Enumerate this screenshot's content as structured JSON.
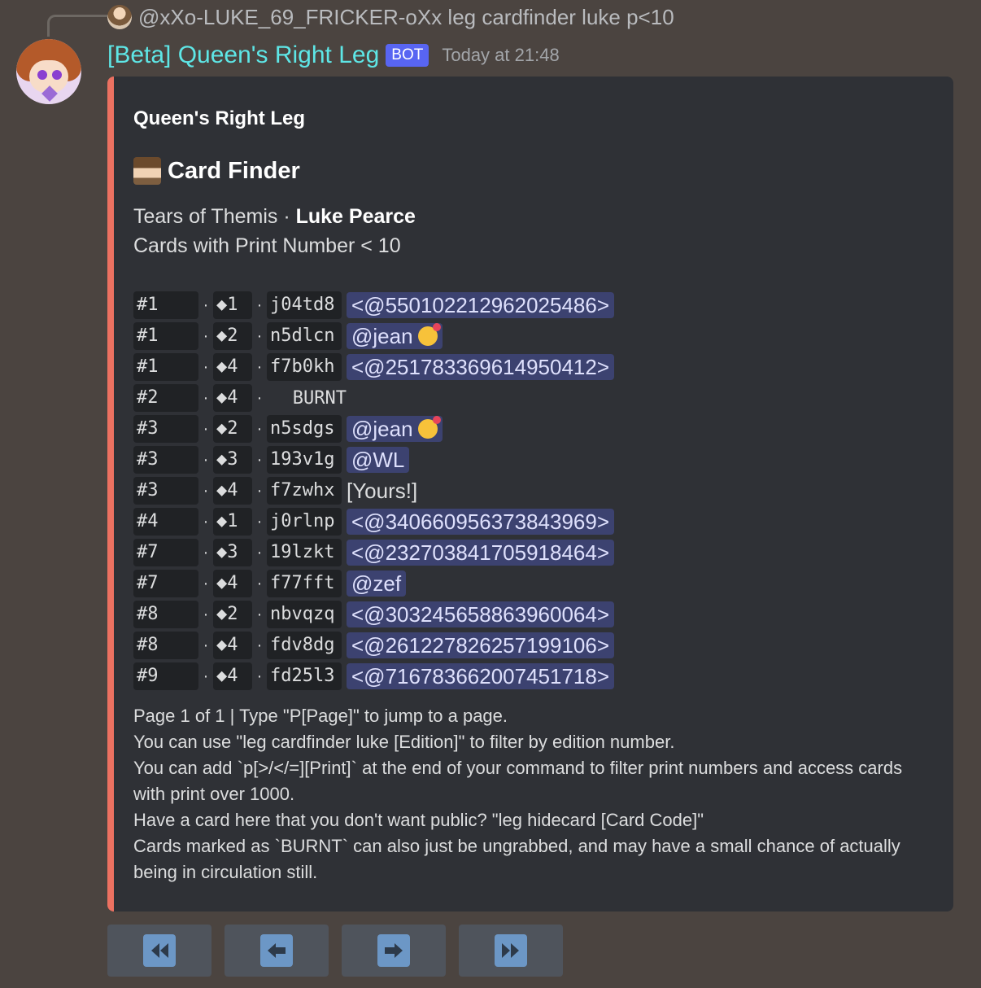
{
  "reply": {
    "text": "@xXo-LUKE_69_FRICKER-oXx leg cardfinder luke p<10"
  },
  "message": {
    "author": "[Beta] Queen's Right Leg",
    "bot_tag": "BOT",
    "timestamp": "Today at 21:48"
  },
  "embed": {
    "accent_color": "#ec7161",
    "author": "Queen's Right Leg",
    "title": "Card Finder",
    "desc_series": "Tears of Themis · ",
    "desc_character": "Luke Pearce",
    "desc_filter": "Cards with Print Number < 10",
    "rows": [
      {
        "num": "#1",
        "edition": "◆1",
        "code": "j04td8",
        "owner": "<@550102212962025486>",
        "type": "mention"
      },
      {
        "num": "#1",
        "edition": "◆2",
        "code": "n5dlcn",
        "owner": "@jean",
        "type": "mention-emoji"
      },
      {
        "num": "#1",
        "edition": "◆4",
        "code": "f7b0kh",
        "owner": "<@251783369614950412>",
        "type": "mention"
      },
      {
        "num": "#2",
        "edition": "◆4",
        "code": "BURNT",
        "owner": "",
        "type": "burnt"
      },
      {
        "num": "#3",
        "edition": "◆2",
        "code": "n5sdgs",
        "owner": "@jean",
        "type": "mention-emoji"
      },
      {
        "num": "#3",
        "edition": "◆3",
        "code": "193v1g",
        "owner": "@WL",
        "type": "mention"
      },
      {
        "num": "#3",
        "edition": "◆4",
        "code": "f7zwhx",
        "owner": "[Yours!]",
        "type": "plain"
      },
      {
        "num": "#4",
        "edition": "◆1",
        "code": "j0rlnp",
        "owner": "<@340660956373843969>",
        "type": "mention"
      },
      {
        "num": "#7",
        "edition": "◆3",
        "code": "19lzkt",
        "owner": "<@232703841705918464>",
        "type": "mention"
      },
      {
        "num": "#7",
        "edition": "◆4",
        "code": "f77fft",
        "owner": "@zef",
        "type": "mention"
      },
      {
        "num": "#8",
        "edition": "◆2",
        "code": "nbvqzq",
        "owner": "<@303245658863960064>",
        "type": "mention"
      },
      {
        "num": "#8",
        "edition": "◆4",
        "code": "fdv8dg",
        "owner": "<@261227826257199106>",
        "type": "mention"
      },
      {
        "num": "#9",
        "edition": "◆4",
        "code": "fd25l3",
        "owner": "<@716783662007451718>",
        "type": "mention"
      }
    ],
    "footer": [
      "Page 1 of 1 | Type \"P[Page]\" to jump to a page.",
      "You can use \"leg cardfinder luke [Edition]\" to filter by edition number.",
      "You can add `p[>/</=][Print]` at the end of your command to filter print numbers and access cards with print over 1000.",
      "Have a card here that you don't want public? \"leg hidecard [Card Code]\"",
      "Cards marked as `BURNT` can also just be ungrabbed, and may have a small chance of actually being in circulation still."
    ]
  },
  "buttons": [
    {
      "name": "first-page-button",
      "icon": "rewind-icon"
    },
    {
      "name": "previous-page-button",
      "icon": "arrow-left-icon"
    },
    {
      "name": "next-page-button",
      "icon": "arrow-right-icon"
    },
    {
      "name": "last-page-button",
      "icon": "fast-forward-icon"
    }
  ]
}
